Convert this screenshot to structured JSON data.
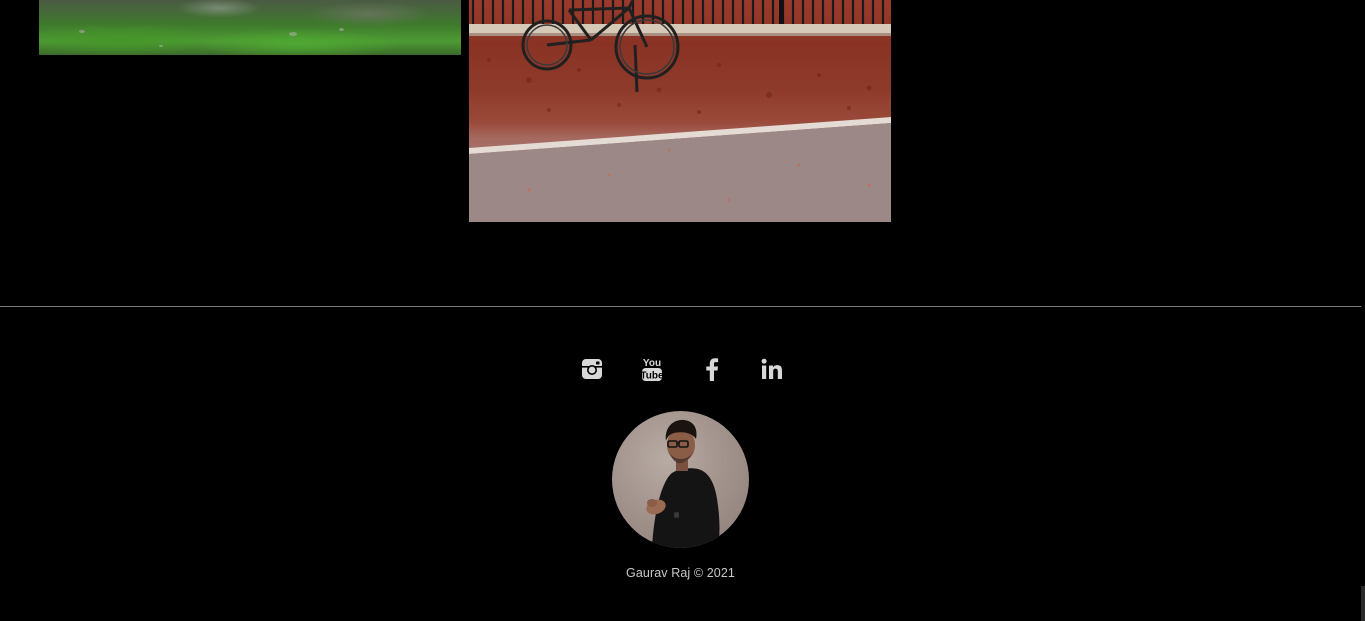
{
  "gallery": {
    "photos": [
      {
        "name": "grass-photo",
        "subject": "grass and rocks"
      },
      {
        "name": "bicycle-photo",
        "subject": "bicycle leaning against fence"
      }
    ]
  },
  "footer": {
    "social": [
      {
        "name": "instagram",
        "icon": "instagram-icon"
      },
      {
        "name": "youtube",
        "icon": "youtube-icon"
      },
      {
        "name": "facebook",
        "icon": "facebook-icon"
      },
      {
        "name": "linkedin",
        "icon": "linkedin-icon"
      }
    ],
    "copyright": "Gaurav Raj © 2021",
    "colors": {
      "background": "#000000",
      "divider": "#7d7d7d",
      "icon": "#d8d8d8",
      "text": "#c9c9c9"
    }
  }
}
